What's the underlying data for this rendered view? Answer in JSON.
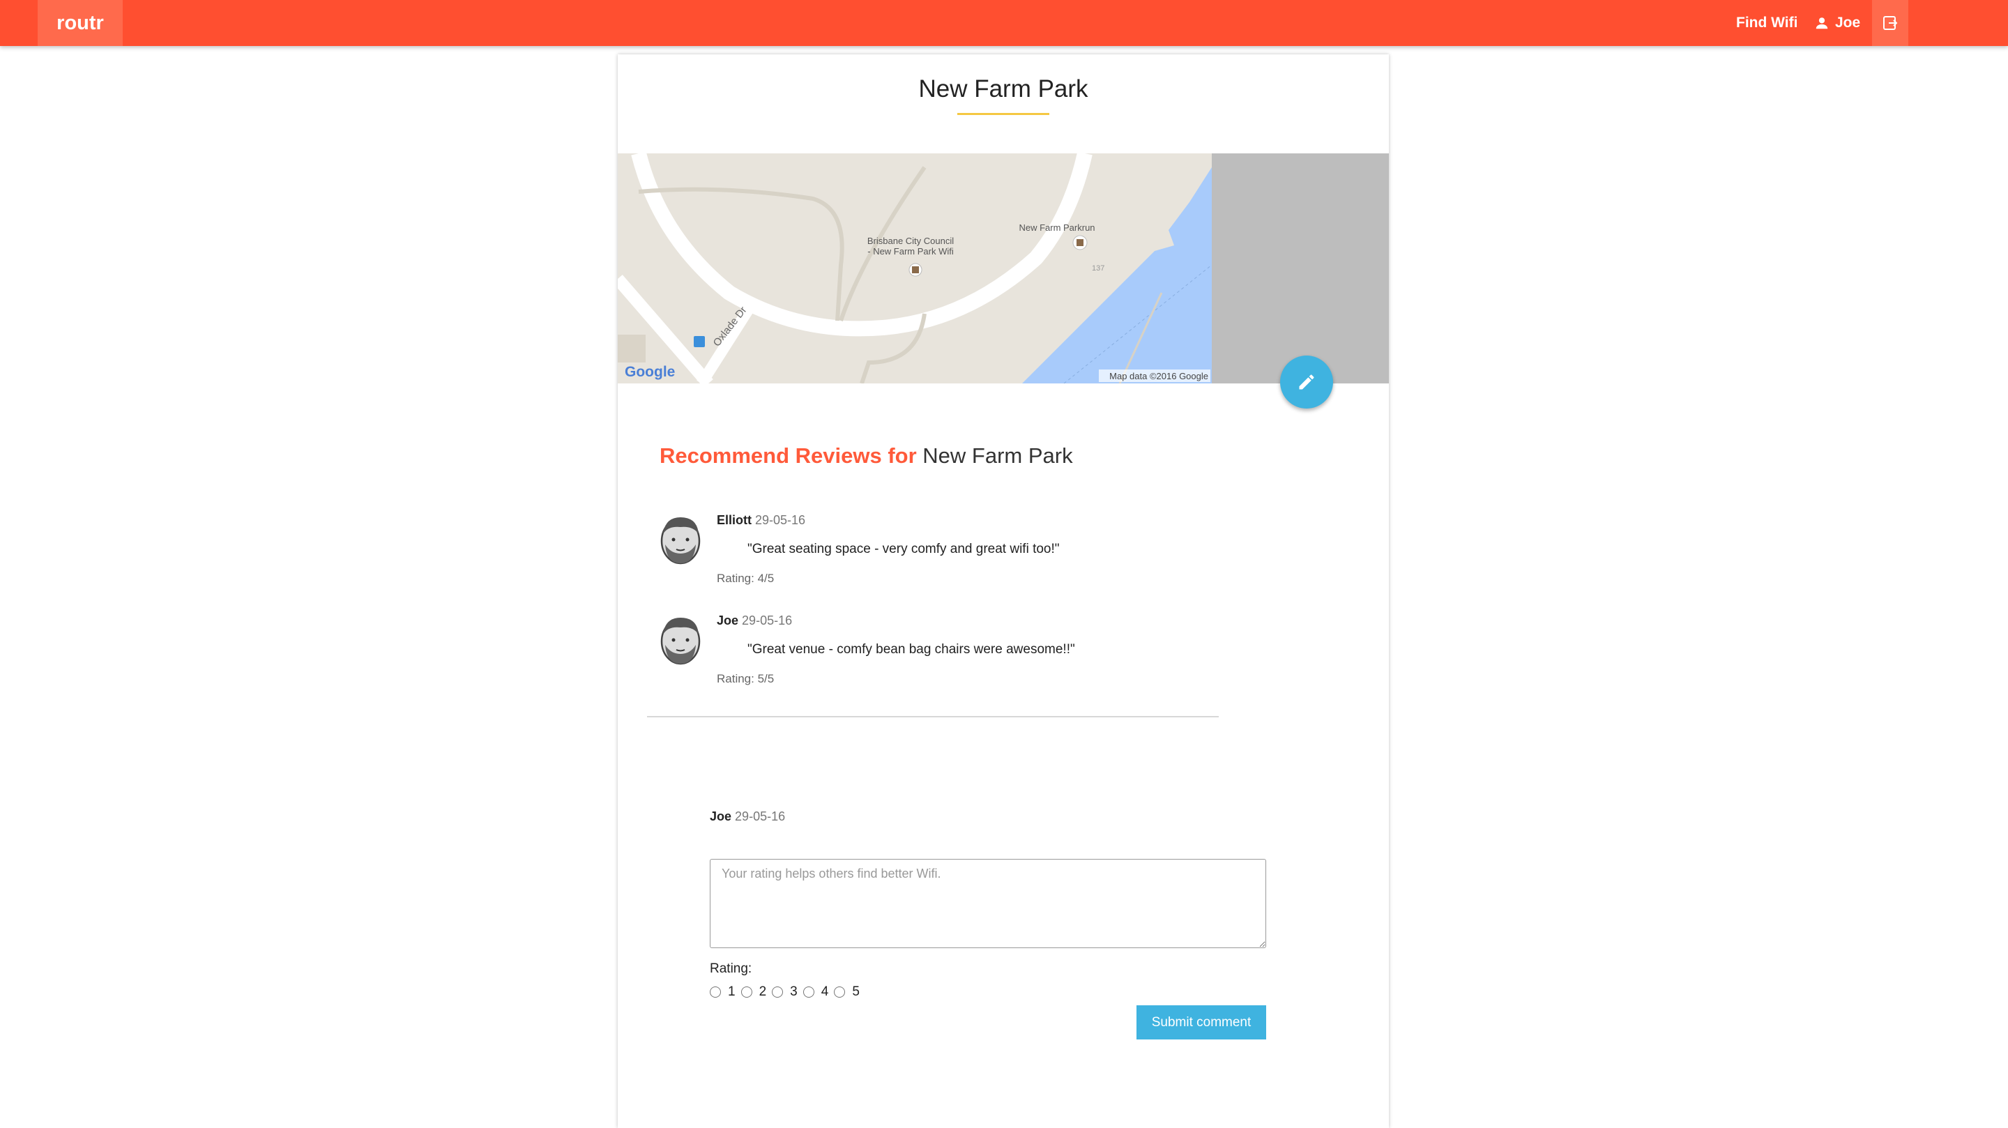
{
  "topbar": {
    "brand": "routr",
    "find_wifi": "Find Wifi",
    "user_name": "Joe",
    "colors": {
      "bar": "#ff4f30",
      "brand_bg": "#ff6a4c"
    }
  },
  "page": {
    "title": "New Farm Park"
  },
  "map": {
    "labels": {
      "poi_wifi_line1": "Brisbane City Council",
      "poi_wifi_line2": "- New Farm Park Wifi",
      "poi_parkrun": "New Farm Parkrun",
      "street": "Oxlade Dr",
      "number": "137",
      "attribution": "Map data ©2016 Google",
      "logo": "Google"
    }
  },
  "reviews": {
    "heading_accent": "Recommend Reviews for",
    "heading_place": "New Farm Park",
    "items": [
      {
        "name": "Elliott",
        "date": "29-05-16",
        "text": "\"Great seating space - very comfy and great wifi too!\"",
        "rating": "Rating: 4/5"
      },
      {
        "name": "Joe",
        "date": "29-05-16",
        "text": "\"Great venue - comfy bean bag chairs were awesome!!\"",
        "rating": "Rating: 5/5"
      }
    ]
  },
  "comment_form": {
    "user_name": "Joe",
    "date": "29-05-16",
    "textarea_placeholder": "Your rating helps others find better Wifi.",
    "textarea_value": "",
    "rating_label": "Rating:",
    "rating_options": [
      "1",
      "2",
      "3",
      "4",
      "5"
    ],
    "submit_label": "Submit comment",
    "accent_color": "#3fb3e0"
  }
}
